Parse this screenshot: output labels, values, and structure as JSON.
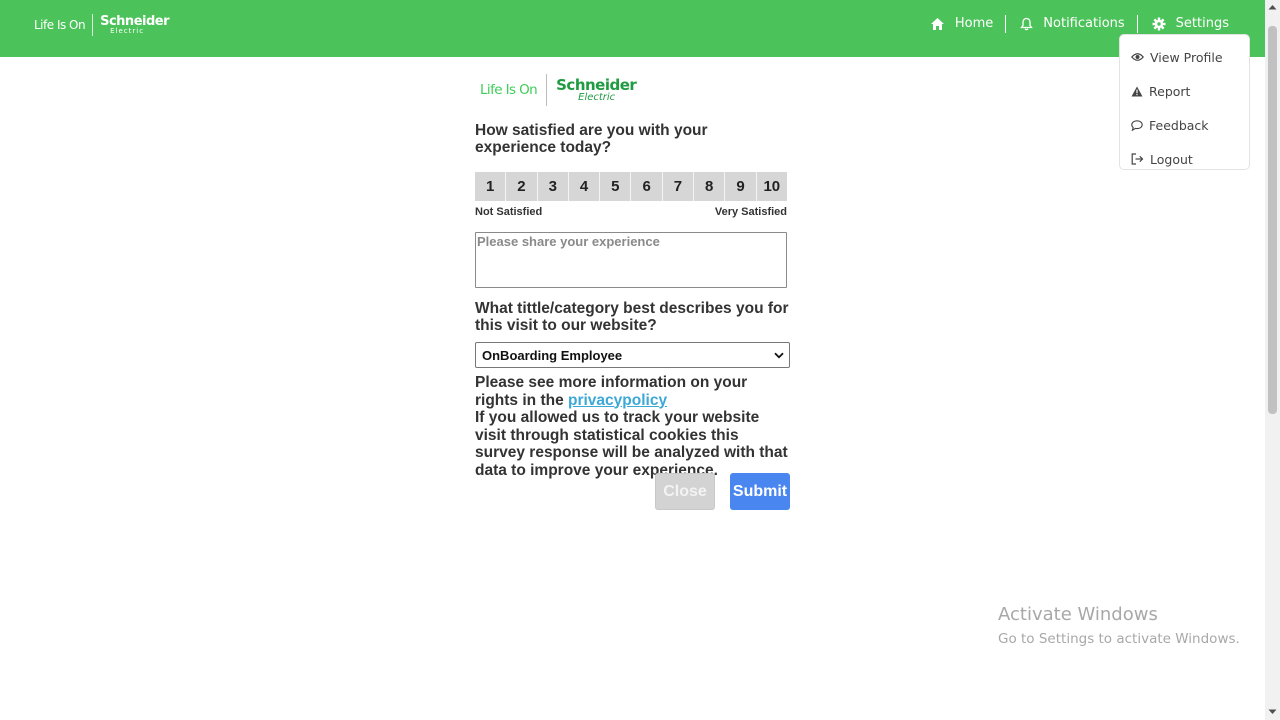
{
  "header": {
    "brand_tagline": "Life Is On",
    "brand_name": "Schneider",
    "brand_sub": "Electric",
    "nav": [
      {
        "label": "Home",
        "icon": "home-icon"
      },
      {
        "label": "Notifications",
        "icon": "bell-icon"
      },
      {
        "label": "Settings",
        "icon": "gear-icon"
      }
    ],
    "accent_color": "#4cc35a"
  },
  "settings_menu": {
    "items": [
      {
        "label": "View Profile",
        "icon": "eye-icon"
      },
      {
        "label": "Report",
        "icon": "warning-icon"
      },
      {
        "label": "Feedback",
        "icon": "chat-bubble-icon"
      },
      {
        "label": "Logout",
        "icon": "logout-icon"
      }
    ]
  },
  "survey": {
    "logo_tagline": "Life Is On",
    "logo_name": "Schneider",
    "logo_sub": "Electric",
    "question1": "How satisfied are you with your experience today?",
    "scale": [
      "1",
      "2",
      "3",
      "4",
      "5",
      "6",
      "7",
      "8",
      "9",
      "10"
    ],
    "scale_low_label": "Not Satisfied",
    "scale_high_label": "Very Satisfied",
    "experience_placeholder": "Please share your experience",
    "question2": "What tittle/category best describes you for this visit to our website?",
    "category_selected": "OnBoarding Employee",
    "privacy_text_before": "Please see more information on your rights in the ",
    "privacy_link": "privacypolicy",
    "tracking_text": "If you allowed us to track your website visit through statistical cookies this survey response will be analyzed with that data to improve your experience.",
    "close_label": "Close",
    "submit_label": "Submit",
    "submit_color": "#4a86f0"
  },
  "watermark": {
    "line1": "Activate Windows",
    "line2": "Go to Settings to activate Windows."
  }
}
